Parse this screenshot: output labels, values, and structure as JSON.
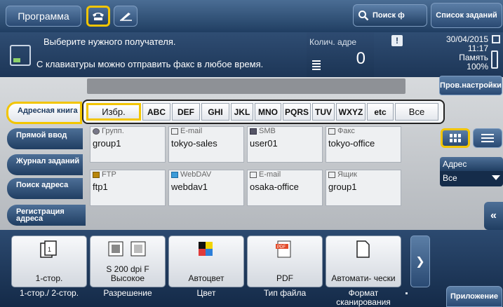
{
  "header": {
    "program_label": "Программа",
    "search_function_label": "Поиск ф",
    "job_list_label": "Список заданий"
  },
  "message": {
    "line1": "Выберите нужного получателя.",
    "line2": "С клавиатуры можно отправить факс в любое время.",
    "dest_count_label": "Колич. адре",
    "dest_count_value": "0",
    "alert_glyph": "!",
    "date": "30/04/2015",
    "time": "11:17",
    "memory_label": "Память",
    "memory_value": "100%"
  },
  "toolbar": {
    "check_settings_label": "Пров.настройки"
  },
  "sidebar": {
    "tabs": [
      {
        "label": "Адресная книга",
        "active": true
      },
      {
        "label": "Прямой ввод",
        "active": false
      },
      {
        "label": "Журнал заданий",
        "active": false
      },
      {
        "label": "Поиск адреса",
        "active": false
      },
      {
        "label": "Регистрация адреса",
        "active": false
      }
    ]
  },
  "index": {
    "keys": [
      "Избр.",
      "ABC",
      "DEF",
      "GHI",
      "JKL",
      "MNO",
      "PQRS",
      "TUV",
      "WXYZ",
      "etc",
      "Все"
    ],
    "selected": "Избр."
  },
  "addresses": [
    {
      "type": "Групп.",
      "name": "group1",
      "icon": "group-icon"
    },
    {
      "type": "E-mail",
      "name": "tokyo-sales",
      "icon": "email-icon"
    },
    {
      "type": "SMB",
      "name": "user01",
      "icon": "smb-icon"
    },
    {
      "type": "Факс",
      "name": "tokyo-office",
      "icon": "fax-icon"
    },
    {
      "type": "FTP",
      "name": "ftp1",
      "icon": "ftp-icon"
    },
    {
      "type": "WebDAV",
      "name": "webdav1",
      "icon": "webdav-icon"
    },
    {
      "type": "E-mail",
      "name": "osaka-office",
      "icon": "email-icon"
    },
    {
      "type": "Ящик",
      "name": "group1",
      "icon": "box-icon"
    }
  ],
  "filter": {
    "label": "Адрес",
    "value": "Все"
  },
  "settings": [
    {
      "value": "1-стор.",
      "caption": "1-стор./ 2-стор.",
      "icon": "duplex-icon"
    },
    {
      "value": "S 200 dpi F Высокое",
      "caption": "Разрешение",
      "icon": "resolution-icon"
    },
    {
      "value": "Автоцвет",
      "caption": "Цвет",
      "icon": "color-icon"
    },
    {
      "value": "PDF",
      "caption": "Тип файла",
      "icon": "pdf-icon"
    },
    {
      "value": "Автомати- чески",
      "caption": "Формат сканирования",
      "icon": "scan-size-icon"
    }
  ],
  "footer": {
    "applications_label": "Приложение"
  },
  "colors": {
    "accent_yellow": "#f2c500",
    "header_blue": "#203e62"
  }
}
